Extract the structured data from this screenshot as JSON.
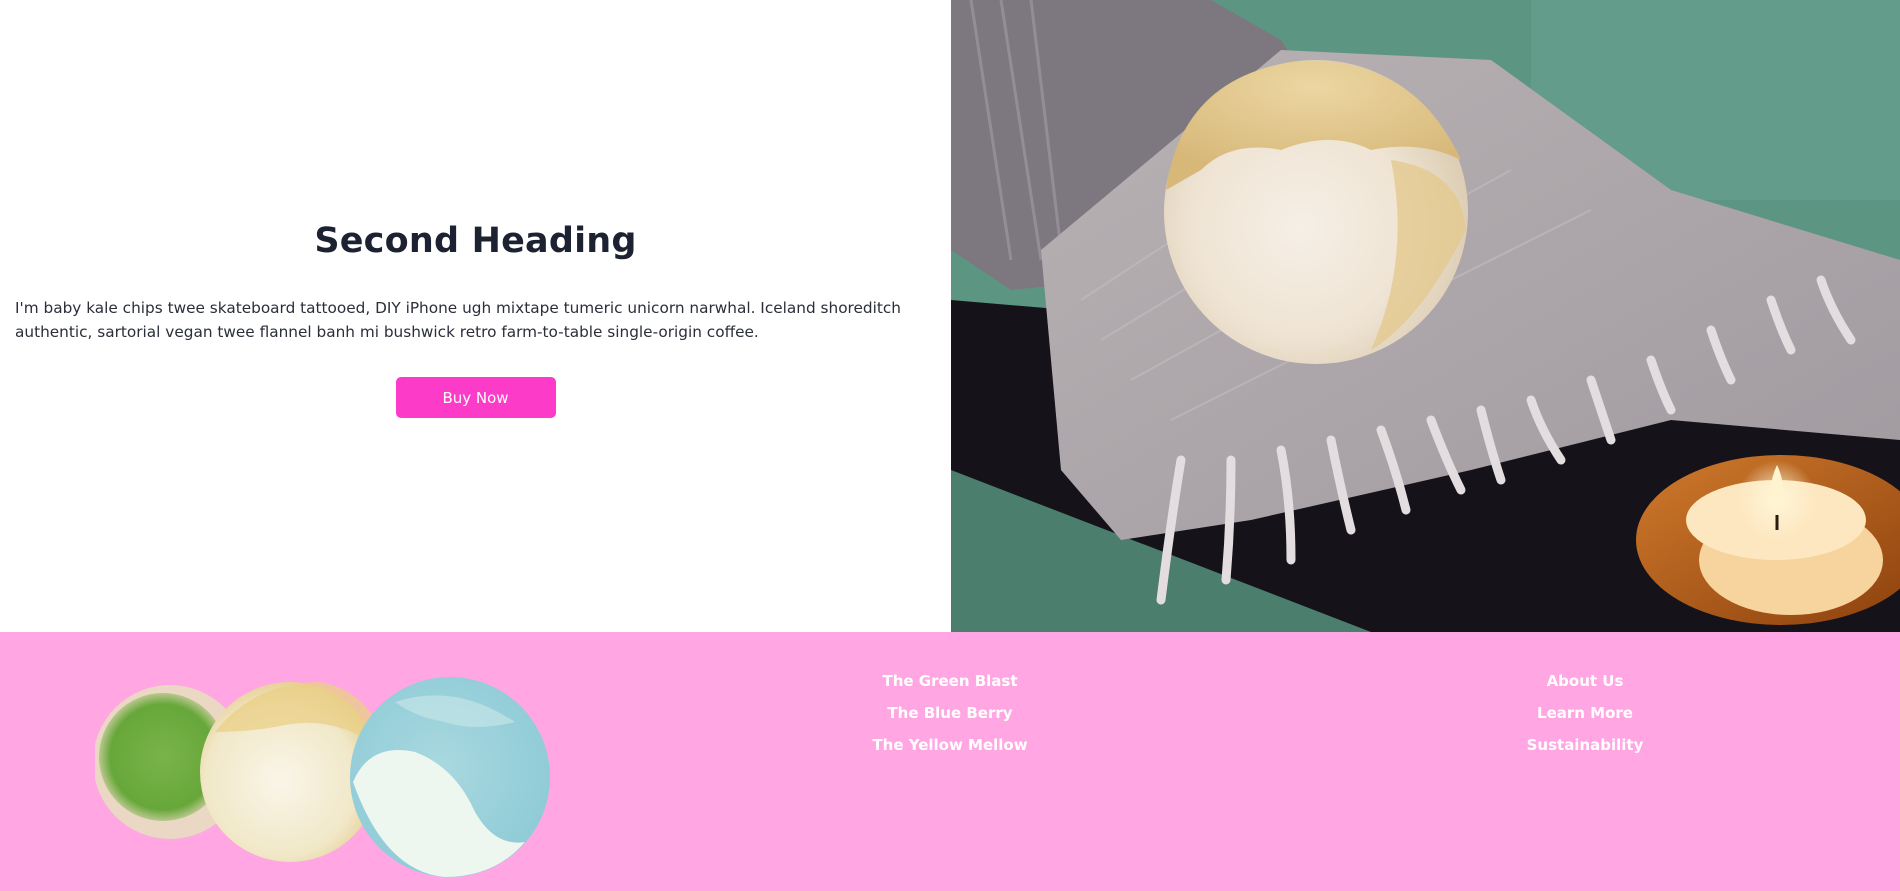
{
  "hero": {
    "heading": "Second Heading",
    "body": "I'm baby kale chips twee skateboard tattooed, DIY iPhone ugh mixtape tumeric unicorn narwhal. Iceland shoreditch authentic, sartorial vegan twee flannel banh mi bushwick retro farm-to-table single-origin coffee.",
    "button_label": "Buy Now"
  },
  "footer": {
    "product_links": [
      {
        "label": "The Green Blast"
      },
      {
        "label": "The Blue Berry"
      },
      {
        "label": "The Yellow Mellow"
      }
    ],
    "company_links": [
      {
        "label": "About Us"
      },
      {
        "label": "Learn More"
      },
      {
        "label": "Sustainability"
      }
    ]
  },
  "colors": {
    "accent": "#fd3bc9",
    "footer_bg": "#ffa6e3",
    "heading": "#1d2233"
  }
}
